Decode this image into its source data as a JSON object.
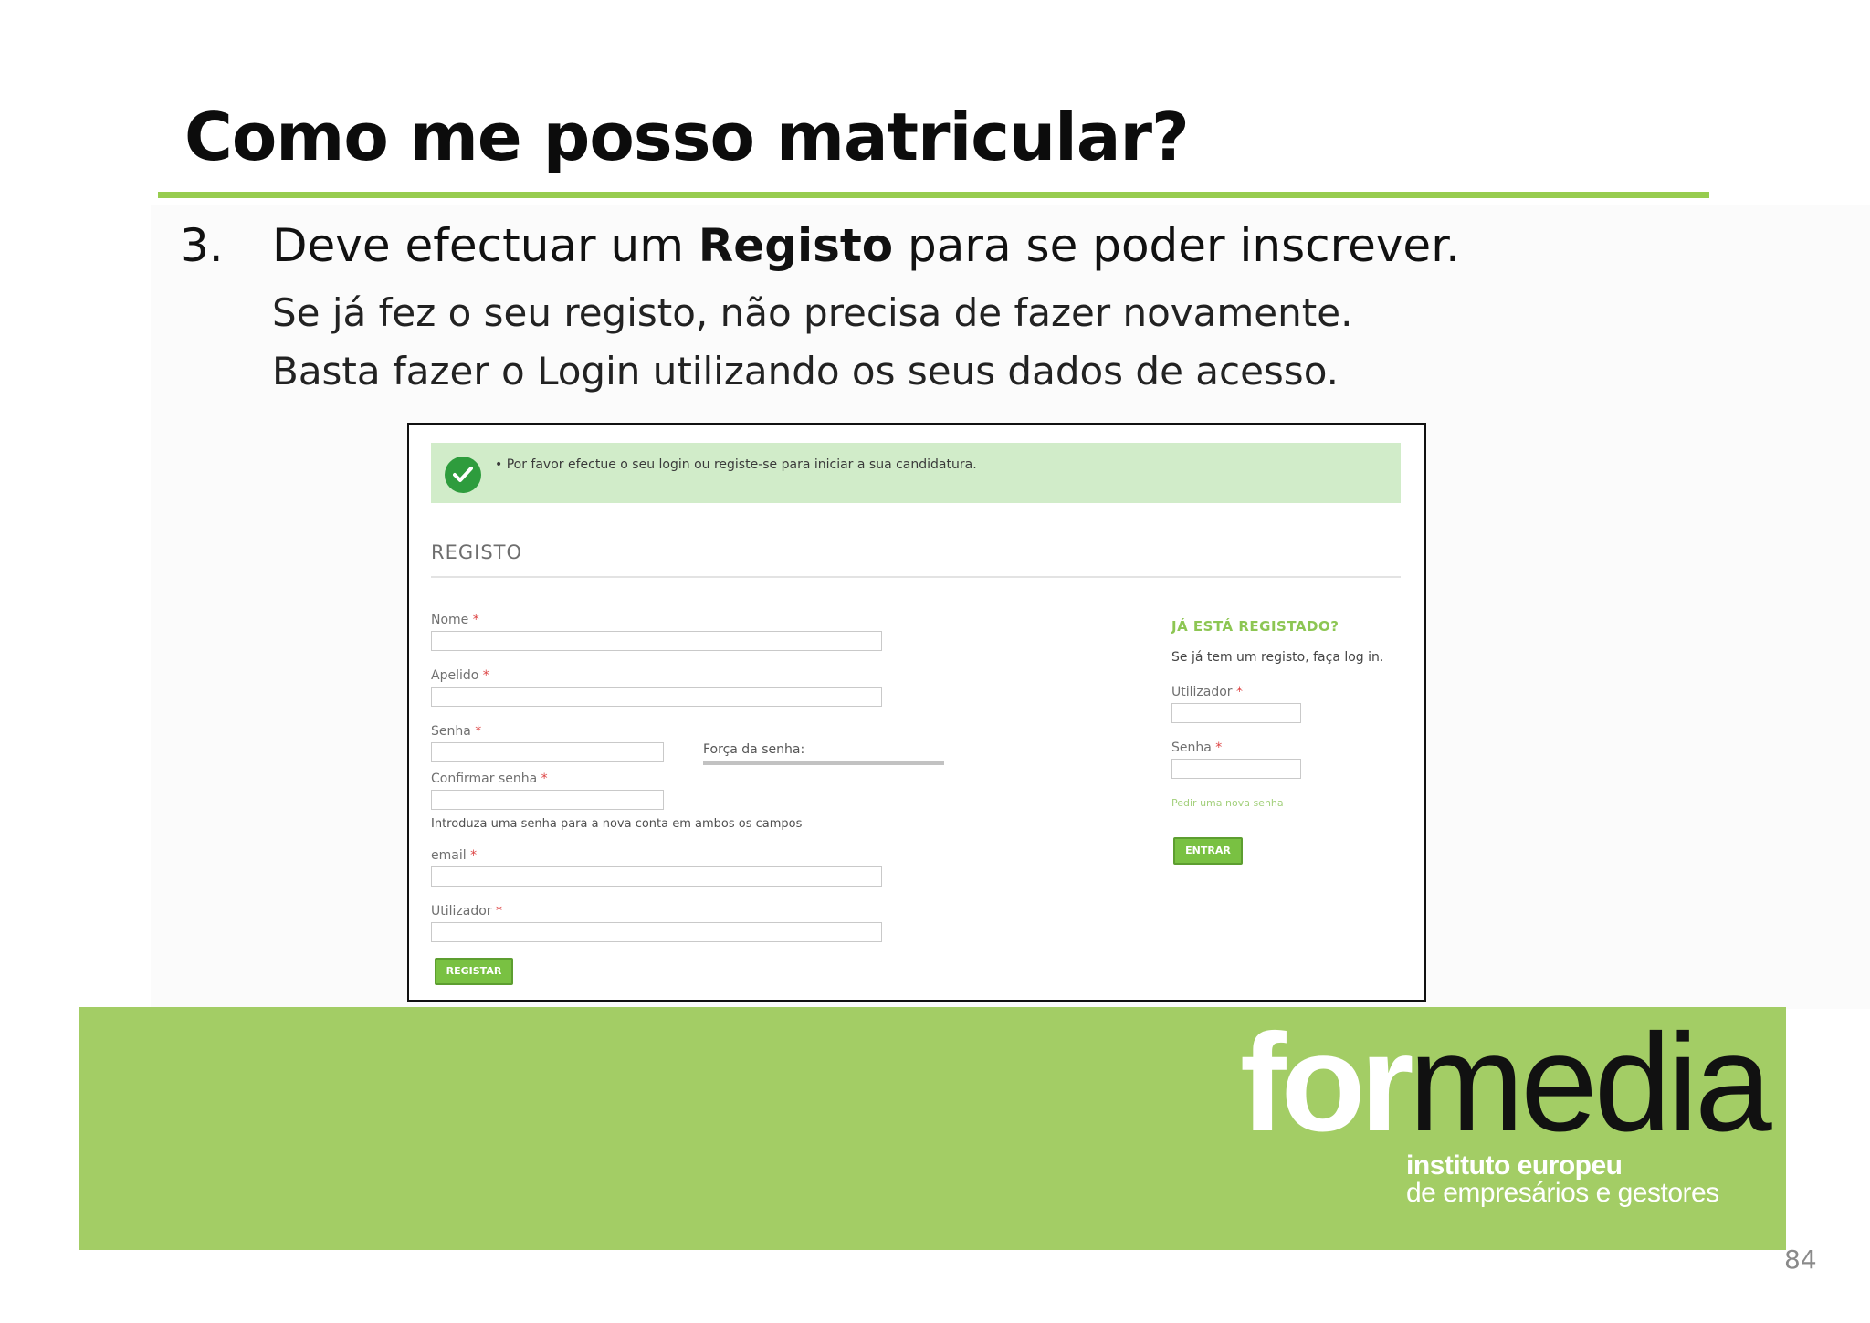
{
  "slide": {
    "title": "Como me posso matricular?",
    "step_number": "3.",
    "step_text_before": "Deve efectuar um ",
    "step_text_bold": "Registo",
    "step_text_after": " para se poder inscrever.",
    "sub_line_1": "Se já fez o seu registo, não precisa de fazer novamente.",
    "sub_line_2": "Basta fazer o Login utilizando os seus dados de acesso.",
    "page_number": "84",
    "accent_color": "#97cc4f"
  },
  "screenshot": {
    "alert_text": "• Por favor efectue o seu login ou registe-se para iniciar a sua candidatura.",
    "alert_icon": "check-icon",
    "form_heading": "REGISTO",
    "fields": {
      "nome": "Nome",
      "apelido": "Apelido",
      "senha": "Senha",
      "confirmar_senha": "Confirmar senha",
      "email": "email",
      "utilizador": "Utilizador"
    },
    "required_marker": "*",
    "strength_label": "Força da senha:",
    "password_hint": "Introduza uma senha para a nova conta em ambos os campos",
    "register_button": "REGISTAR",
    "login_panel": {
      "title": "JÁ ESTÁ REGISTADO?",
      "text": "Se já tem um registo, faça log in.",
      "username_label": "Utilizador",
      "password_label": "Senha",
      "forgot_link": "Pedir uma nova senha",
      "login_button": "ENTRAR"
    },
    "button_color": "#79c142"
  },
  "banner": {
    "logo_part1": "for",
    "logo_part2": "media",
    "tagline_1": "instituto europeu",
    "tagline_2": "de empresários e gestores",
    "color": "#a3cd65"
  }
}
